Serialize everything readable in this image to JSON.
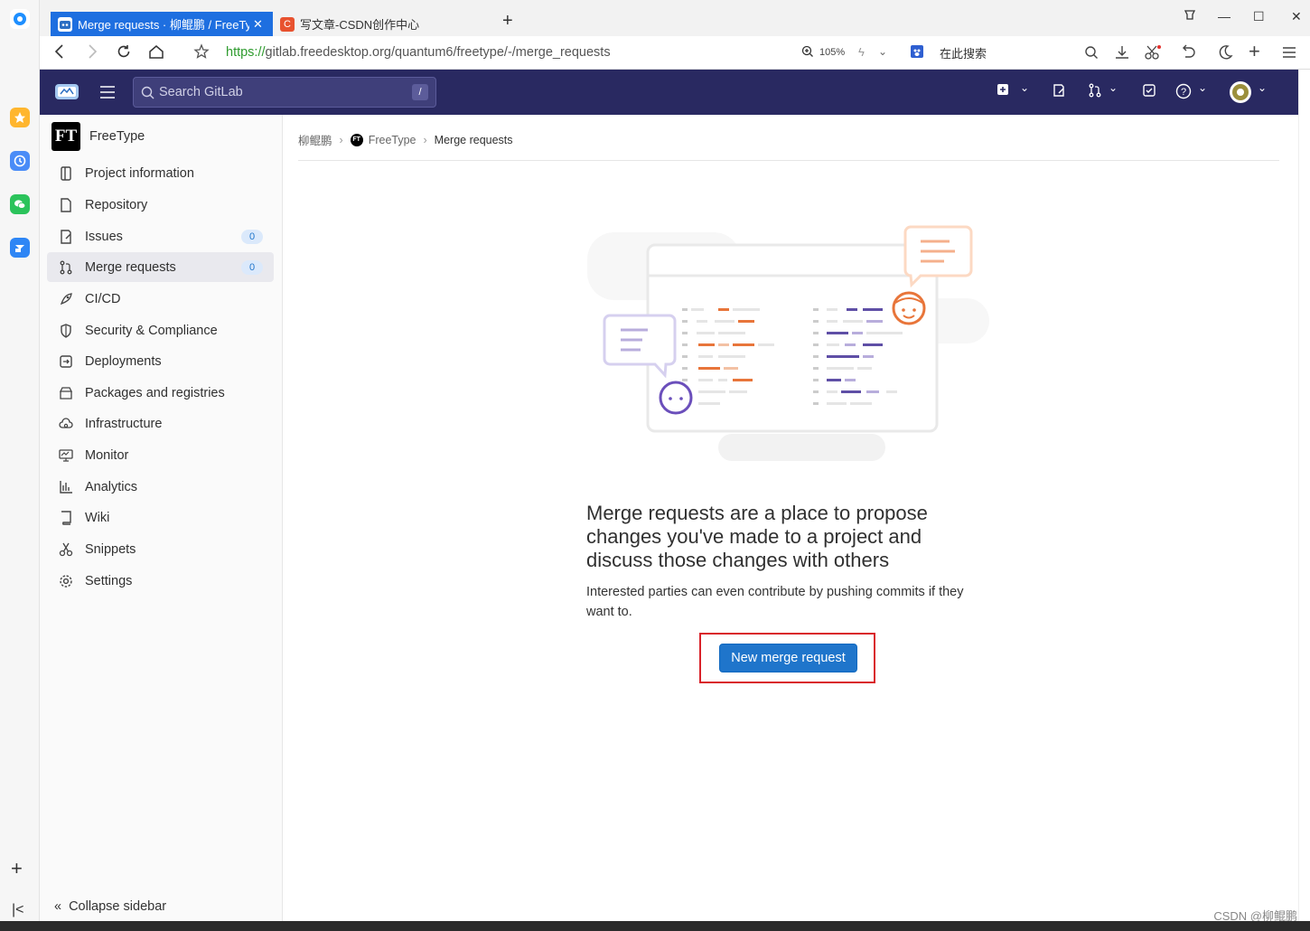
{
  "browser": {
    "tabs": [
      {
        "label": "Merge requests · 柳鲲鹏 / FreeType · GitLab",
        "active": true
      },
      {
        "label": "写文章-CSDN创作中心",
        "active": false
      }
    ],
    "url_proto": "https://",
    "url_rest": "gitlab.freedesktop.org/quantum6/freetype/-/merge_requests",
    "zoom": "105%",
    "search_engine_placeholder": "在此搜索"
  },
  "header": {
    "search_placeholder": "Search GitLab",
    "search_shortcut": "/"
  },
  "sidebar": {
    "project_logo": "FT",
    "project_name": "FreeType",
    "items": [
      {
        "label": "Project information",
        "icon": "info-doc-icon"
      },
      {
        "label": "Repository",
        "icon": "doc-icon"
      },
      {
        "label": "Issues",
        "icon": "issues-icon",
        "badge": "0"
      },
      {
        "label": "Merge requests",
        "icon": "merge-request-icon",
        "badge": "0",
        "active": true
      },
      {
        "label": "CI/CD",
        "icon": "rocket-icon"
      },
      {
        "label": "Security & Compliance",
        "icon": "shield-icon"
      },
      {
        "label": "Deployments",
        "icon": "deployments-icon"
      },
      {
        "label": "Packages and registries",
        "icon": "package-icon"
      },
      {
        "label": "Infrastructure",
        "icon": "cloud-gear-icon"
      },
      {
        "label": "Monitor",
        "icon": "monitor-icon"
      },
      {
        "label": "Analytics",
        "icon": "chart-icon"
      },
      {
        "label": "Wiki",
        "icon": "book-icon"
      },
      {
        "label": "Snippets",
        "icon": "scissors-icon"
      },
      {
        "label": "Settings",
        "icon": "gear-icon"
      }
    ],
    "collapse_label": "Collapse sidebar"
  },
  "breadcrumb": {
    "user": "柳鲲鹏",
    "project": "FreeType",
    "current": "Merge requests"
  },
  "empty_state": {
    "title": "Merge requests are a place to propose changes you've made to a project and discuss those changes with others",
    "description": "Interested parties can even contribute by pushing commits if they want to.",
    "button_label": "New merge request"
  },
  "watermark": "CSDN @柳鲲鹏",
  "colors": {
    "header_bg": "#292961",
    "primary_button": "#1f75cb",
    "highlight_box": "#d9222a",
    "tab_active": "#1e6fe0"
  }
}
